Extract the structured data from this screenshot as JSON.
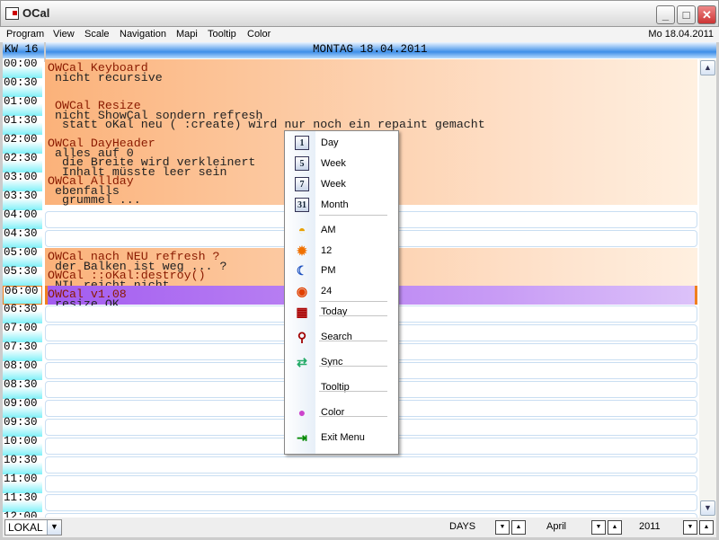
{
  "window": {
    "title": "OCal"
  },
  "menubar": {
    "items": [
      "Program",
      "View",
      "Scale",
      "Navigation",
      "Mapi",
      "Tooltip",
      "Color"
    ],
    "date": "Mo 18.04.2011"
  },
  "header": {
    "week": "KW 16",
    "day": "MONTAG 18.04.2011"
  },
  "times": [
    "00:00",
    "00:30",
    "01:00",
    "01:30",
    "02:00",
    "02:30",
    "03:00",
    "03:30",
    "04:00",
    "04:30",
    "05:00",
    "05:30",
    "06:00",
    "06:30",
    "07:00",
    "07:30",
    "08:00",
    "08:30",
    "09:00",
    "09:30",
    "10:00",
    "10:30",
    "11:00",
    "11:30",
    "12:00"
  ],
  "events": [
    {
      "start": "00:00",
      "end": "04:00",
      "color": "#fbb27a",
      "lines": [
        "OWCal Keyboard",
        " nicht recursive",
        "",
        "",
        " OWCal Resize",
        " nicht ShowCal sondern refresh",
        "  statt oKal neu ( :create) wird nur noch ein repaint gemacht",
        "",
        "OWCal DayHeader",
        " alles auf 0",
        "  die Breite wird verkleinert",
        "  Inhalt müsste leer sein",
        "OWCal Allday",
        " ebenfalls",
        "  grummel ...",
        "."
      ]
    },
    {
      "start": "05:00",
      "end": "06:00",
      "color": "#fbb27a",
      "lines": [
        "OWCal nach NEU refresh ?",
        " der Balken ist weg ... ?",
        "OWCal ::oKal:destroy()",
        " NIL reicht nicht"
      ]
    },
    {
      "start": "06:00",
      "end": "06:30",
      "color": "#a35cf0",
      "lines": [
        "OWCal v1.08",
        " resize OK"
      ]
    }
  ],
  "context_menu": {
    "items": [
      {
        "label": "Day",
        "icon": "calendar-1-icon",
        "glyph": "1"
      },
      {
        "label": "Week",
        "icon": "calendar-5-icon",
        "glyph": "5"
      },
      {
        "label": "Week",
        "icon": "calendar-7-icon",
        "glyph": "7"
      },
      {
        "label": "Month",
        "icon": "calendar-31-icon",
        "glyph": "31",
        "sep": true
      },
      {
        "label": "AM",
        "icon": "sunrise-icon"
      },
      {
        "label": "12",
        "icon": "sun-icon"
      },
      {
        "label": "PM",
        "icon": "moon-icon"
      },
      {
        "label": "24",
        "icon": "clock-24-icon",
        "sep": true
      },
      {
        "label": "Today",
        "icon": "calendar-today-icon",
        "sep": true
      },
      {
        "label": "Search",
        "icon": "magnifier-icon",
        "sep": true
      },
      {
        "label": "Sync",
        "icon": "sync-icon",
        "sep": true
      },
      {
        "label": "Tooltip",
        "icon": "",
        "sep": true
      },
      {
        "label": "Color",
        "icon": "color-wheel-icon",
        "sep": true
      },
      {
        "label": "Exit Menu",
        "icon": "exit-icon"
      }
    ]
  },
  "status": {
    "mode": "LOKAL",
    "unit": "DAYS",
    "month": "April",
    "year": "2011"
  }
}
